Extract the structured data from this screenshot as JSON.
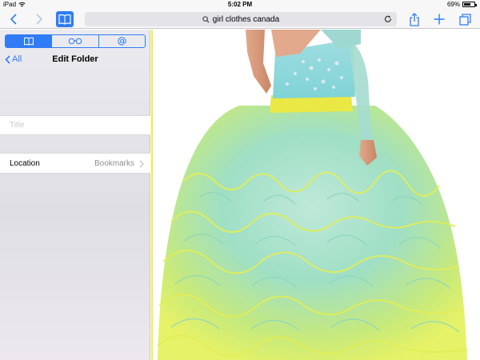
{
  "status_bar": {
    "carrier": "iPad",
    "time": "5:02 PM",
    "battery": "69%",
    "battery_level": 0.69
  },
  "toolbar": {
    "back_icon": "chevron-left-icon",
    "forward_icon": "chevron-right-icon",
    "bookmarks_icon": "open-book-icon",
    "search_icon": "magnifier-icon",
    "address_text": "girl clothes canada",
    "reload_icon": "reload-icon",
    "share_icon": "share-icon",
    "add_icon": "plus-icon",
    "tabs_icon": "tabs-icon",
    "accent_color": "#2f7cf6"
  },
  "sidebar": {
    "segments": [
      {
        "icon": "open-book-icon",
        "active": true
      },
      {
        "icon": "reading-glasses-icon",
        "active": false
      },
      {
        "icon": "at-sign-icon",
        "active": false
      }
    ],
    "back_label": "All",
    "title": "Edit Folder",
    "title_field_placeholder": "Title",
    "title_field_value": "",
    "location_label": "Location",
    "location_value": "Bookmarks"
  },
  "content": {
    "image_description": "girl-dress-photo"
  }
}
